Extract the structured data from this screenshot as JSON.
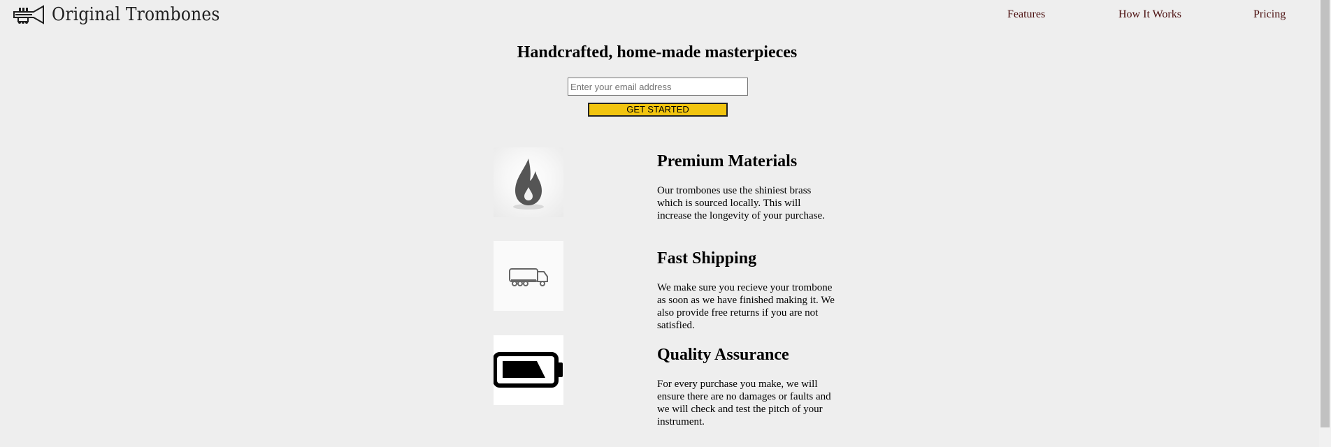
{
  "header": {
    "logo_text": "Original Trombones",
    "logo_icon": "trumpet-icon",
    "nav": [
      "Features",
      "How It Works",
      "Pricing"
    ]
  },
  "hero": {
    "title": "Handcrafted, home-made masterpieces",
    "email_placeholder": "Enter your email address",
    "cta_label": "GET STARTED"
  },
  "features": [
    {
      "icon": "flame-icon",
      "title": "Premium Materials",
      "text": "Our trombones use the shiniest brass which is sourced locally. This will increase the longevity of your purchase."
    },
    {
      "icon": "truck-icon",
      "title": "Fast Shipping",
      "text": "We make sure you recieve your trombone as soon as we have finished making it. We also provide free returns if you are not satisfied."
    },
    {
      "icon": "battery-icon",
      "title": "Quality Assurance",
      "text": "For every purchase you make, we will ensure there are no damages or faults and we will check and test the pitch of your instrument."
    }
  ],
  "colors": {
    "background": "#eeeeee",
    "cta": "#f1c40f",
    "nav_link": "#4a0e0e"
  }
}
